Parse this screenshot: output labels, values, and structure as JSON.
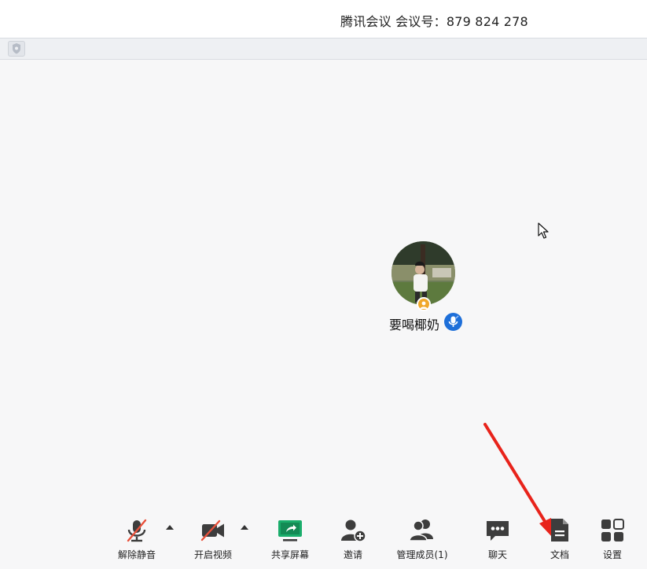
{
  "window": {
    "title": "腾讯会议 会议号：879 824 278"
  },
  "participant": {
    "name": "要喝椰奶",
    "avatar_icon": "avatar-photo",
    "host_badge_icon": "host-icon",
    "mic_status_icon": "mic-active-icon"
  },
  "toolbar": {
    "unmute": {
      "label": "解除静音",
      "icon": "mic-muted-icon"
    },
    "start_video": {
      "label": "开启视频",
      "icon": "camera-off-icon"
    },
    "share_screen": {
      "label": "共享屏幕",
      "icon": "share-screen-icon"
    },
    "invite": {
      "label": "邀请",
      "icon": "add-user-icon"
    },
    "manage_members": {
      "label": "管理成员(1)",
      "icon": "members-icon"
    },
    "chat": {
      "label": "聊天",
      "icon": "chat-icon"
    },
    "documents": {
      "label": "文档",
      "icon": "document-icon"
    },
    "settings": {
      "label": "设置",
      "icon": "grid-icon"
    }
  },
  "colors": {
    "accent_green": "#1aad6b",
    "muted_red": "#e8503a",
    "host_badge": "#f0a82b",
    "mic_badge": "#1e6fd9",
    "annotation_arrow": "#e8231b"
  }
}
